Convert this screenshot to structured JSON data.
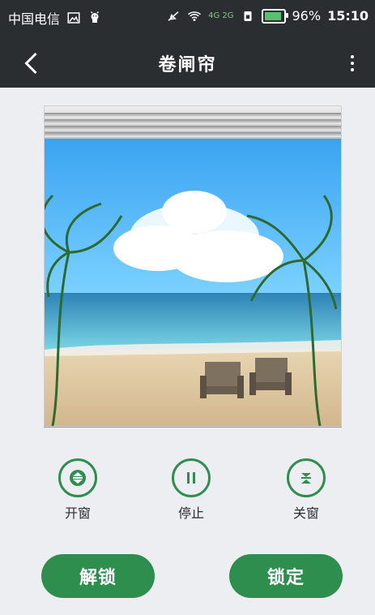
{
  "status": {
    "carrier": "中国电信",
    "battery_percent_text": "96%",
    "battery_fill": 0.96,
    "time": "15:10",
    "network_label": "4G 2G"
  },
  "appbar": {
    "title": "卷闸帘"
  },
  "controls": [
    {
      "label": "开窗"
    },
    {
      "label": "停止"
    },
    {
      "label": "关窗"
    }
  ],
  "actions": {
    "unlock": "解锁",
    "lock": "锁定"
  },
  "colors": {
    "appbar_bg": "#2B2E31",
    "accent_green": "#2E8E4E",
    "page_bg": "#ECEEF1"
  },
  "icons": {
    "back": "chevron-left-icon",
    "more": "more-vertical-icon",
    "open": "open-window-icon",
    "stop": "pause-icon",
    "close": "close-window-icon"
  }
}
